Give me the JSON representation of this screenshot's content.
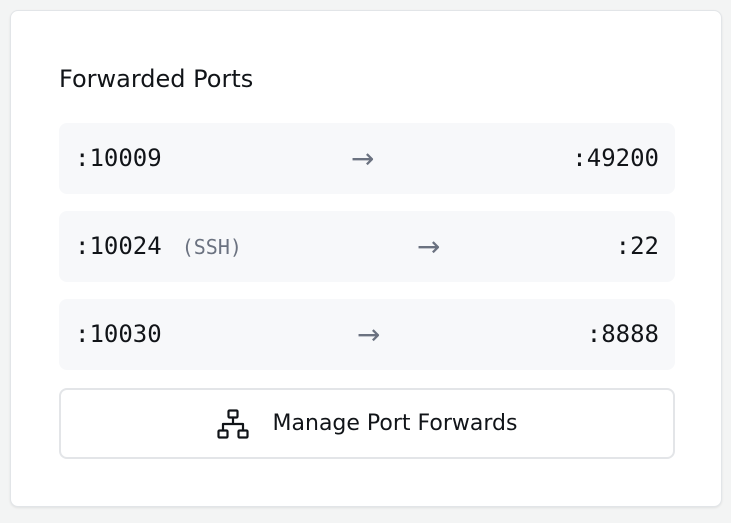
{
  "panel": {
    "title": "Forwarded Ports"
  },
  "ports": [
    {
      "local": ":10009",
      "tag": "",
      "arrow": "→",
      "remote": ":49200"
    },
    {
      "local": ":10024",
      "tag": "(SSH)",
      "arrow": "→",
      "remote": ":22"
    },
    {
      "local": ":10030",
      "tag": "",
      "arrow": "→",
      "remote": ":8888"
    }
  ],
  "manage_button": {
    "label": "Manage Port Forwards",
    "icon": "network-icon"
  }
}
